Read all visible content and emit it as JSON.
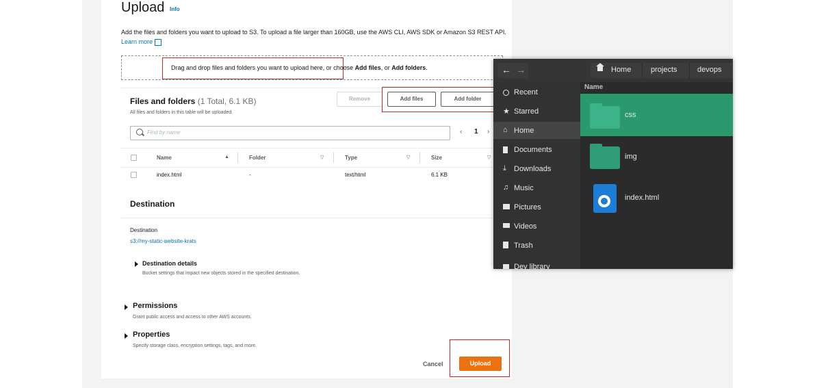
{
  "page": {
    "title": "Upload",
    "info_link": "Info",
    "description": "Add the files and folders you want to upload to S3. To upload a file larger than 160GB, use the AWS CLI, AWS SDK or Amazon S3 REST API.",
    "learn_more": "Learn more"
  },
  "dropzone": {
    "text_prefix": "Drag and drop files and folders you want to upload here, or choose ",
    "add_files_bold": "Add files",
    "middle": ", or ",
    "add_folders_bold": "Add folders",
    "suffix": "."
  },
  "files_panel": {
    "title": "Files and folders",
    "count": "(1 Total, 6.1 KB)",
    "subtitle": "All files and folders in this table will be uploaded.",
    "remove_label": "Remove",
    "add_files_label": "Add files",
    "add_folder_label": "Add folder",
    "search_placeholder": "Find by name",
    "page_prev": "‹",
    "page_number": "1",
    "page_next": "›",
    "columns": [
      "Name",
      "Folder",
      "Type",
      "Size"
    ],
    "rows": [
      {
        "name": "index.html",
        "folder": "-",
        "type": "text/html",
        "size": "6.1 KB"
      }
    ]
  },
  "destination": {
    "title": "Destination",
    "label": "Destination",
    "link": "s3://my-static-website-krats",
    "details_title": "Destination details",
    "details_sub": "Bucket settings that impact new objects stored in the specified destination."
  },
  "permissions": {
    "title": "Permissions",
    "sub": "Grant public access and access to other AWS accounts."
  },
  "properties": {
    "title": "Properties",
    "sub": "Specify storage class, encryption settings, tags, and more."
  },
  "actions": {
    "cancel": "Cancel",
    "upload": "Upload"
  },
  "file_dialog": {
    "back": "←",
    "forward": "→",
    "path": [
      "Home",
      "projects",
      "devops"
    ],
    "sidebar": [
      "Recent",
      "Starred",
      "Home",
      "Documents",
      "Downloads",
      "Music",
      "Pictures",
      "Videos",
      "Trash",
      "Dev library"
    ],
    "column_name": "Name",
    "items": [
      {
        "name": "css",
        "kind": "folder"
      },
      {
        "name": "img",
        "kind": "folder"
      },
      {
        "name": "index.html",
        "kind": "file"
      }
    ]
  },
  "colors": {
    "accent_link": "#0073bb",
    "upload_orange": "#ec7211",
    "highlight_red": "#c0292a",
    "dialog_selection": "#2a9a6e"
  }
}
